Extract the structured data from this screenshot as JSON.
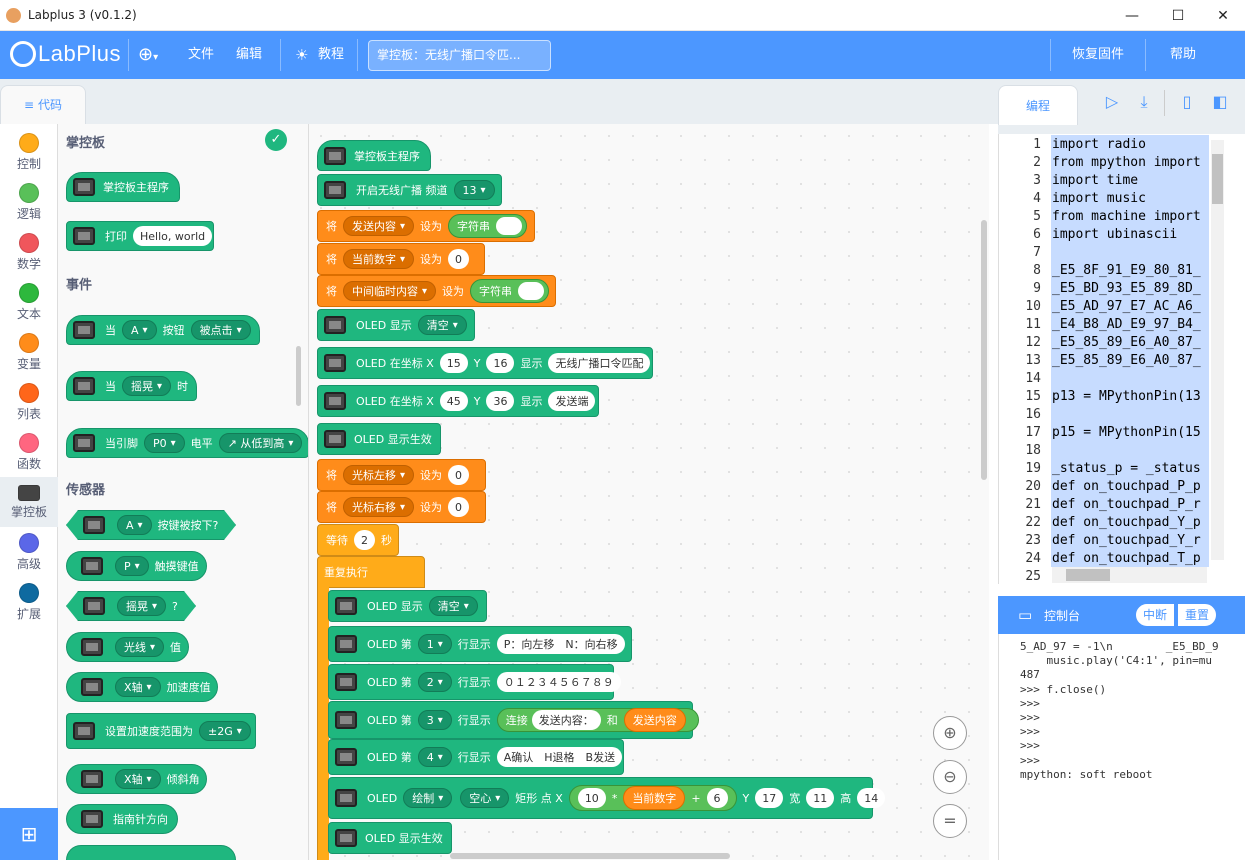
{
  "window": {
    "title": "Labplus 3 (v0.1.2)",
    "minimize": "—",
    "maximize": "☐",
    "close": "✕"
  },
  "menubar": {
    "logo": "LabPlus",
    "language_icon": "globe-icon",
    "file": "文件",
    "edit": "编辑",
    "tutorial": "教程",
    "project_title": "掌控板：无线广播口令匹...",
    "restore_firmware": "恢复固件",
    "help": "帮助"
  },
  "code_tab": "代码",
  "categories": [
    {
      "label": "控制",
      "color": "#ffab19"
    },
    {
      "label": "逻辑",
      "color": "#59c059"
    },
    {
      "label": "数学",
      "color": "#ff6680"
    },
    {
      "label": "文本",
      "color": "#40bf4a"
    },
    {
      "label": "变量",
      "color": "#ff8c1a"
    },
    {
      "label": "列表",
      "color": "#ff661a"
    },
    {
      "label": "函数",
      "color": "#ff6680"
    },
    {
      "label": "掌控板",
      "color": "#4a4a4a"
    },
    {
      "label": "高级",
      "color": "#5b67e8"
    },
    {
      "label": "扩展",
      "color": "#0e6aa0"
    }
  ],
  "flyout": {
    "section_board": "掌控板",
    "main_program": "掌控板主程序",
    "print": "打印",
    "print_value": "Hello, world",
    "section_events": "事件",
    "when": "当",
    "button_a": "A",
    "button_word": "按钮",
    "clicked": "被点击",
    "shake": "摇晃",
    "time_word": "时",
    "when_pin": "当引脚",
    "pin_p0": "P0",
    "level": "电平",
    "low_to_high": "↗ 从低到高",
    "section_sensors": "传感器",
    "button_pressed": "按键被按下?",
    "touch_p": "P",
    "touch_value": "触摸键值",
    "shake_q": "?",
    "light": "光线",
    "value_word": "值",
    "x_axis": "X轴",
    "accel": "加速度值",
    "set_range": "设置加速度范围为",
    "range_2g": "±2G",
    "tilt": "倾斜角",
    "compass": "指南针方向"
  },
  "workspace": {
    "main_program": "掌控板主程序",
    "open_radio": "开启无线广播 频道",
    "channel": "13",
    "set_word": "将",
    "var_send": "发送内容",
    "set_to": "设为",
    "string_word": "字符串",
    "var_current": "当前数字",
    "zero": "0",
    "var_temp": "中间临时内容",
    "oled_show": "OLED 显示",
    "clear": "清空",
    "oled_at": "OLED 在坐标 X",
    "x1": "15",
    "y_word": "Y",
    "y1": "16",
    "show_word": "显示",
    "text1": "无线广播口令匹配",
    "x2": "45",
    "y2": "36",
    "text2": "发送端",
    "oled_effect": "OLED 显示生效",
    "var_cursor_left": "光标左移",
    "var_cursor_right": "光标右移",
    "wait": "等待",
    "wait_sec": "2",
    "seconds": "秒",
    "repeat": "重复执行",
    "oled_line": "OLED 第",
    "line_show": "行显示",
    "line1": "1",
    "line1_text": "P：向左移　N：向右移",
    "line2": "2",
    "line2_text": "０１２３４５６７８９",
    "line3": "3",
    "join": "连接",
    "join_a": "发送内容：",
    "and_word": "和",
    "line4": "4",
    "line4_text": "A确认　H退格　B发送",
    "oled": "OLED",
    "draw": "绘制",
    "hollow": "空心",
    "rect_x": "矩形 点 X",
    "rx_a": "10",
    "mul": "*",
    "plus": "+",
    "rx_b": "6",
    "ry": "17",
    "width_word": "宽",
    "rw": "11",
    "height_word": "高",
    "rh": "14",
    "oled_effect2": "OLED 显示生效"
  },
  "right_panel": {
    "editor_tab": "编程",
    "console_title": "控制台",
    "interrupt": "中断",
    "reset": "重置"
  },
  "code_lines": [
    {
      "n": "1",
      "t": "import radio"
    },
    {
      "n": "2",
      "t": "from mpython import"
    },
    {
      "n": "3",
      "t": "import time"
    },
    {
      "n": "4",
      "t": "import music"
    },
    {
      "n": "5",
      "t": "from machine import"
    },
    {
      "n": "6",
      "t": "import ubinascii"
    },
    {
      "n": "7",
      "t": ""
    },
    {
      "n": "8",
      "t": "_E5_8F_91_E9_80_81_"
    },
    {
      "n": "9",
      "t": "_E5_BD_93_E5_89_8D_"
    },
    {
      "n": "10",
      "t": "_E5_AD_97_E7_AC_A6_"
    },
    {
      "n": "11",
      "t": "_E4_B8_AD_E9_97_B4_"
    },
    {
      "n": "12",
      "t": "_E5_85_89_E6_A0_87_"
    },
    {
      "n": "13",
      "t": "_E5_85_89_E6_A0_87_"
    },
    {
      "n": "14",
      "t": ""
    },
    {
      "n": "15",
      "t": "p13 = MPythonPin(13"
    },
    {
      "n": "16",
      "t": ""
    },
    {
      "n": "17",
      "t": "p15 = MPythonPin(15"
    },
    {
      "n": "18",
      "t": ""
    },
    {
      "n": "19",
      "t": "_status_p = _status"
    },
    {
      "n": "20",
      "t": "def on_touchpad_P_p"
    },
    {
      "n": "21",
      "t": "def on_touchpad_P_r"
    },
    {
      "n": "22",
      "t": "def on_touchpad_Y_p"
    },
    {
      "n": "23",
      "t": "def on_touchpad_Y_r"
    },
    {
      "n": "24",
      "t": "def on_touchpad_T_p"
    },
    {
      "n": "25",
      "t": ""
    }
  ],
  "console_lines": [
    "5_AD_97 = -1\\n        _E5_BD_9",
    "    music.play('C4:1', pin=mu",
    "487",
    ">>> f.close()",
    ">>>",
    ">>>",
    ">>>",
    ">>>",
    ">>>",
    "mpython: soft reboot"
  ]
}
